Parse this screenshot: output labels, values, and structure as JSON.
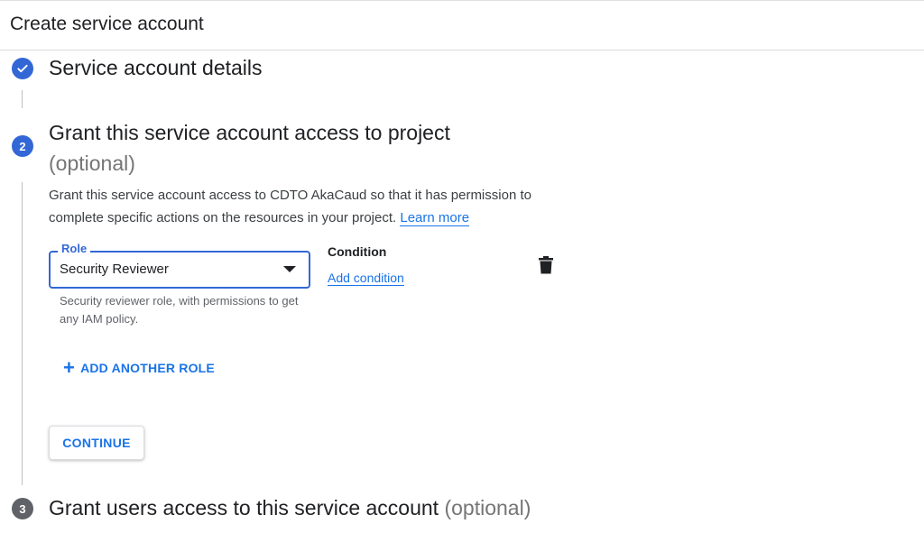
{
  "header": {
    "title": "Create service account"
  },
  "steps": [
    {
      "number": "1",
      "title": "Service account details",
      "status": "complete"
    },
    {
      "number": "2",
      "title": "Grant this service account access to project",
      "optional": "(optional)"
    },
    {
      "number": "3",
      "title": "Grant users access to this service account",
      "optional": "(optional)"
    }
  ],
  "step2": {
    "description": "Grant this service account access to CDTO AkaCaud so that it has permission to complete specific actions on the resources in your project.",
    "learn_more": "Learn more",
    "role": {
      "label": "Role",
      "value": "Security Reviewer",
      "hint": "Security reviewer role, with permissions to get any IAM policy."
    },
    "condition": {
      "label": "Condition",
      "link": "Add condition"
    },
    "add_role": "ADD ANOTHER ROLE",
    "continue": "CONTINUE"
  },
  "colors": {
    "accent": "#3367d6",
    "link": "#1a73e8",
    "inactive_step": "#5f6368"
  }
}
